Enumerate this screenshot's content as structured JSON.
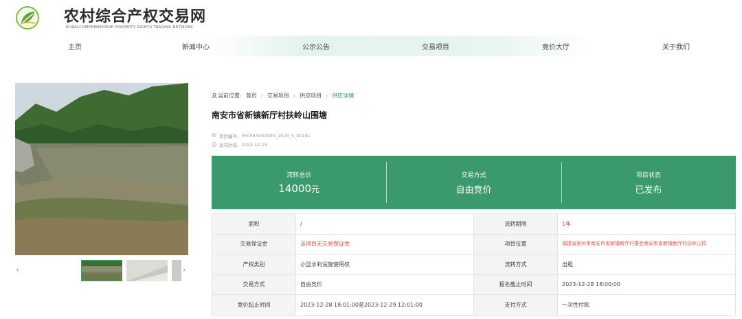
{
  "header": {
    "title": "农村综合产权交易网",
    "subtitle": "RURALCOMPREHENSIVE PROPERTY RIGHTS TRADING NETWORK",
    "logo_icon": "leaf-logo-icon",
    "brand_color": "#3a9a6b"
  },
  "nav": {
    "items": [
      "主页",
      "新闻中心",
      "公示公告",
      "交易项目",
      "竞价大厅",
      "关于我们"
    ]
  },
  "gallery": {
    "prev_arrow": "‹",
    "next_arrow": "›"
  },
  "breadcrumb": {
    "prefix": "当前位置:",
    "items": [
      "首页",
      "交易项目",
      "供应项目",
      "供应详情"
    ],
    "separator": "›"
  },
  "project": {
    "title": "南安市省新镇新厅村扶岭山围塘",
    "number_label": "项目编号:",
    "number": "350583000000_2023_5_00191",
    "date_label": "发布时间:",
    "date": "2023-12-15"
  },
  "summary": {
    "price_label": "流转总价",
    "price_value": "14000",
    "price_unit": "元",
    "method_label": "交易方式",
    "method_value": "自由竞价",
    "status_label": "项目状态",
    "status_value": "已发布"
  },
  "details": {
    "rows": [
      {
        "k1": "面积",
        "v1": "/",
        "k2": "流转期限",
        "v2": "1年"
      },
      {
        "k1": "交易保证金",
        "v1": "该项目无交易保证金",
        "k2": "项目位置",
        "v2": "福建省泉州市南安市省新镇新厅村委会南安市省新镇新厅村扶岭山顶"
      },
      {
        "k1": "产权类别",
        "v1": "小型水利设施使用权",
        "k2": "流转方式",
        "v2": "出租"
      },
      {
        "k1": "交易方式",
        "v1": "自由竞价",
        "k2": "报名截止时间",
        "v2": "2023-12-28 18:00:00"
      },
      {
        "k1": "竞价起止时间",
        "v1": "2023-12-28 18:01:00至2023-12-29 12:01:00",
        "k2": "支付方式",
        "v2": "一次性付款"
      }
    ]
  }
}
